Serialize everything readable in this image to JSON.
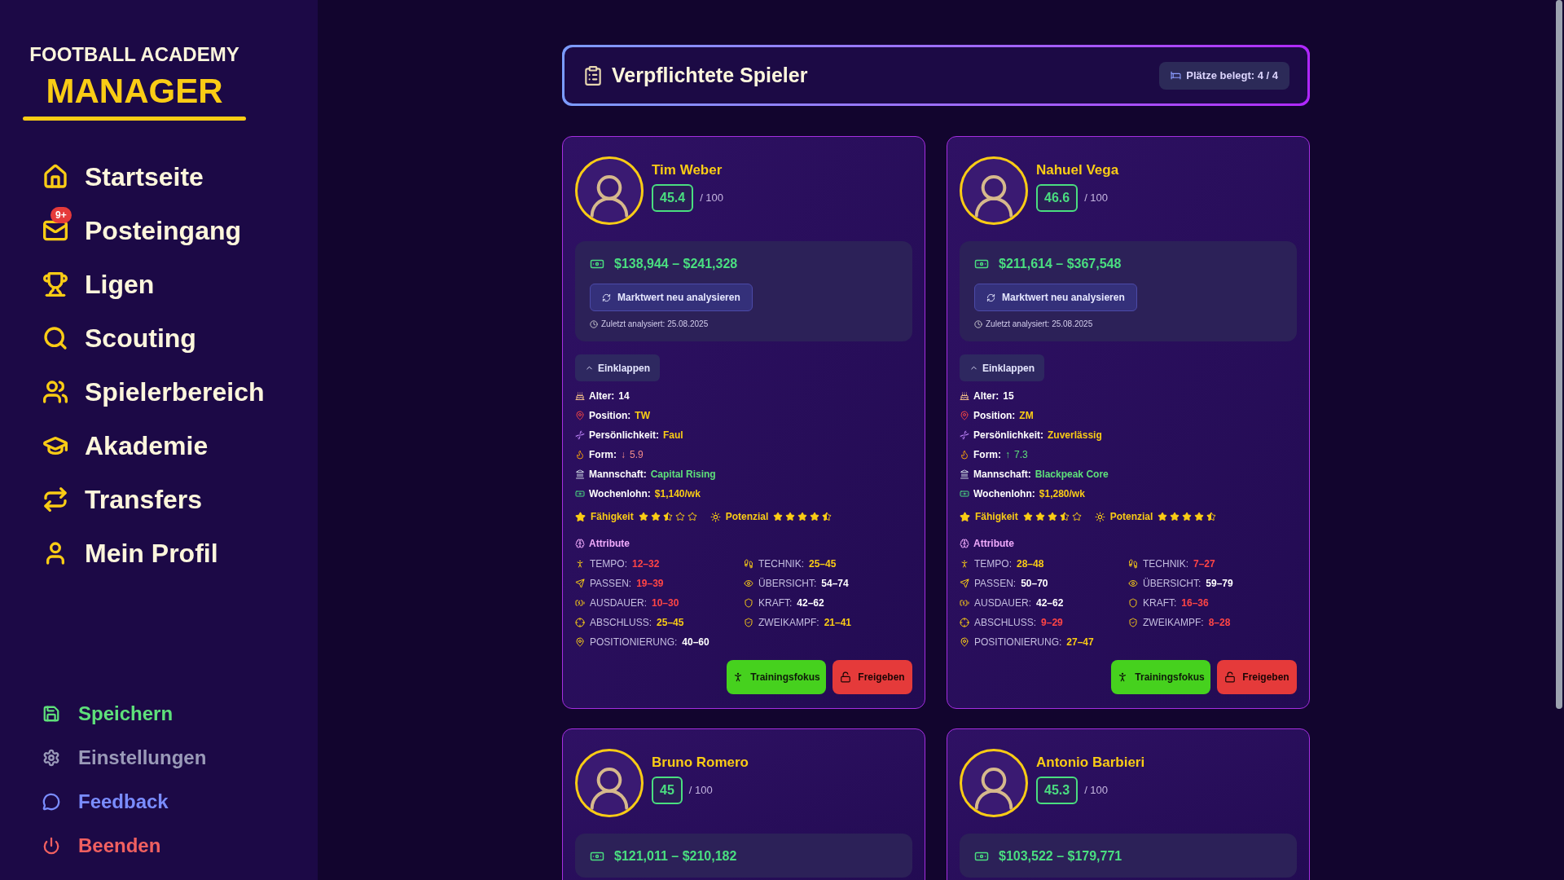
{
  "sidebar": {
    "logo_top": "FOOTBALL ACADEMY",
    "logo_main": "MANAGER",
    "nav": [
      {
        "label": "Startseite",
        "selected": false
      },
      {
        "label": "Posteingang",
        "selected": false,
        "badge": "9+"
      },
      {
        "label": "Ligen",
        "selected": false
      },
      {
        "label": "Scouting",
        "selected": false
      },
      {
        "label": "Spielerbereich",
        "selected": false
      },
      {
        "label": "Akademie",
        "selected": false
      },
      {
        "label": "Transfers",
        "selected": false
      },
      {
        "label": "Mein Profil",
        "selected": false
      }
    ],
    "actions": [
      {
        "label": "Speichern",
        "color": "#5ee07a"
      },
      {
        "label": "Einstellungen",
        "color": "#9a9ab8"
      },
      {
        "label": "Feedback",
        "color": "#7a8cff"
      },
      {
        "label": "Beenden",
        "color": "#f06060"
      }
    ]
  },
  "header": {
    "title": "Verpflichtete Spieler",
    "slots": "Plätze belegt: 4 / 4"
  },
  "players": [
    {
      "name": "Tim Weber",
      "rating": "45.4",
      "rating_max": "/ 100",
      "market_value": "$138,944 – $241,328",
      "reanalyze_button": "Marktwert neu analysieren",
      "last_analyzed": "Zuletzt analysiert: 25.08.2025",
      "collapse_button": "Einklappen",
      "expanded": true,
      "details": [
        {
          "label": "Alter:",
          "value": "14",
          "color": "#ffffff"
        },
        {
          "label": "Position:",
          "value": "TW",
          "color": "#facc15"
        },
        {
          "label": "Persönlichkeit:",
          "value": "Faul",
          "color": "#facc15"
        },
        {
          "label": "Form:",
          "value": "5.9",
          "color": "#f08a8a",
          "arrow": "↓"
        },
        {
          "label": "Mannschaft:",
          "value": "Capital Rising",
          "color": "#5ee07a"
        },
        {
          "label": "Wochenlohn:",
          "value": "$1,140/wk",
          "color": "#facc15"
        }
      ],
      "ratings": [
        {
          "label": "Fähigkeit",
          "stars": 2.5
        },
        {
          "label": "Potenzial",
          "stars": 4.5
        }
      ],
      "attributes_title": "Attribute",
      "attributes": [
        {
          "label": "TEMPO:",
          "value": "12–32",
          "color": "#ff4545"
        },
        {
          "label": "TECHNIK:",
          "value": "25–45",
          "color": "#facc15"
        },
        {
          "label": "PASSEN:",
          "value": "19–39",
          "color": "#ff4545"
        },
        {
          "label": "ÜBERSICHT:",
          "value": "54–74",
          "color": "#ffffff"
        },
        {
          "label": "AUSDAUER:",
          "value": "10–30",
          "color": "#ff4545"
        },
        {
          "label": "KRAFT:",
          "value": "42–62",
          "color": "#ffffff"
        },
        {
          "label": "ABSCHLUSS:",
          "value": "25–45",
          "color": "#facc15"
        },
        {
          "label": "ZWEIKAMPF:",
          "value": "21–41",
          "color": "#facc15"
        },
        {
          "label": "POSITIONIERUNG:",
          "value": "40–60",
          "color": "#ffffff"
        }
      ],
      "buttons": [
        {
          "label": "Trainingsfokus",
          "kind": "train"
        },
        {
          "label": "Freigeben",
          "kind": "release"
        }
      ]
    },
    {
      "name": "Nahuel Vega",
      "rating": "46.6",
      "rating_max": "/ 100",
      "market_value": "$211,614 – $367,548",
      "reanalyze_button": "Marktwert neu analysieren",
      "last_analyzed": "Zuletzt analysiert: 25.08.2025",
      "collapse_button": "Einklappen",
      "expanded": true,
      "details": [
        {
          "label": "Alter:",
          "value": "15",
          "color": "#ffffff"
        },
        {
          "label": "Position:",
          "value": "ZM",
          "color": "#facc15"
        },
        {
          "label": "Persönlichkeit:",
          "value": "Zuverlässig",
          "color": "#facc15"
        },
        {
          "label": "Form:",
          "value": "7.3",
          "color": "#5ee07a",
          "arrow": "↑"
        },
        {
          "label": "Mannschaft:",
          "value": "Blackpeak Core",
          "color": "#5ee07a"
        },
        {
          "label": "Wochenlohn:",
          "value": "$1,280/wk",
          "color": "#facc15"
        }
      ],
      "ratings": [
        {
          "label": "Fähigkeit",
          "stars": 3.5
        },
        {
          "label": "Potenzial",
          "stars": 4.5
        }
      ],
      "attributes_title": "Attribute",
      "attributes": [
        {
          "label": "TEMPO:",
          "value": "28–48",
          "color": "#facc15"
        },
        {
          "label": "TECHNIK:",
          "value": "7–27",
          "color": "#ff4545"
        },
        {
          "label": "PASSEN:",
          "value": "50–70",
          "color": "#ffffff"
        },
        {
          "label": "ÜBERSICHT:",
          "value": "59–79",
          "color": "#ffffff"
        },
        {
          "label": "AUSDAUER:",
          "value": "42–62",
          "color": "#ffffff"
        },
        {
          "label": "KRAFT:",
          "value": "16–36",
          "color": "#ff4545"
        },
        {
          "label": "ABSCHLUSS:",
          "value": "9–29",
          "color": "#ff4545"
        },
        {
          "label": "ZWEIKAMPF:",
          "value": "8–28",
          "color": "#ff4545"
        },
        {
          "label": "POSITIONIERUNG:",
          "value": "27–47",
          "color": "#facc15"
        }
      ],
      "buttons": [
        {
          "label": "Trainingsfokus",
          "kind": "train"
        },
        {
          "label": "Freigeben",
          "kind": "release"
        }
      ]
    },
    {
      "name": "Bruno Romero",
      "rating": "45",
      "rating_max": "/ 100",
      "market_value": "$121,011 – $210,182"
    },
    {
      "name": "Antonio Barbieri",
      "rating": "45.3",
      "rating_max": "/ 100",
      "market_value": "$103,522 – $179,771"
    }
  ]
}
